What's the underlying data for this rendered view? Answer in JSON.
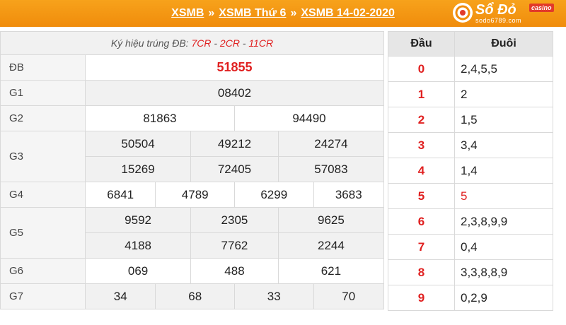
{
  "header": {
    "crumbs": [
      "XSMB",
      "XSMB Thứ 6",
      "XSMB 14-02-2020"
    ],
    "separator": "»",
    "background": "#f39515",
    "logo": {
      "name": "Sổ Đỏ",
      "badge": "casino",
      "url": "sodo6789.com"
    }
  },
  "results": {
    "note_prefix": "Ký hiệu trúng ĐB: ",
    "note_codes": [
      "7CR",
      "2CR",
      "11CR"
    ],
    "note_sep": " - ",
    "prizes": [
      {
        "label": "ĐB",
        "rows": [
          [
            "51855"
          ]
        ]
      },
      {
        "label": "G1",
        "rows": [
          [
            "08402"
          ]
        ]
      },
      {
        "label": "G2",
        "rows": [
          [
            "81863",
            "94490"
          ]
        ]
      },
      {
        "label": "G3",
        "rows": [
          [
            "50504",
            "49212",
            "24274"
          ],
          [
            "15269",
            "72405",
            "57083"
          ]
        ]
      },
      {
        "label": "G4",
        "rows": [
          [
            "6841",
            "4789",
            "6299",
            "3683"
          ]
        ]
      },
      {
        "label": "G5",
        "rows": [
          [
            "9592",
            "2305",
            "9625"
          ],
          [
            "4188",
            "7762",
            "2244"
          ]
        ]
      },
      {
        "label": "G6",
        "rows": [
          [
            "069",
            "488",
            "621"
          ]
        ]
      },
      {
        "label": "G7",
        "rows": [
          [
            "34",
            "68",
            "33",
            "70"
          ]
        ]
      }
    ]
  },
  "dau_duoi": {
    "headers": [
      "Đầu",
      "Đuôi"
    ],
    "rows": [
      {
        "dau": "0",
        "duoi": "2,4,5,5"
      },
      {
        "dau": "1",
        "duoi": "2"
      },
      {
        "dau": "2",
        "duoi": "1,5"
      },
      {
        "dau": "3",
        "duoi": "3,4"
      },
      {
        "dau": "4",
        "duoi": "1,4"
      },
      {
        "dau": "5",
        "duoi": "5"
      },
      {
        "dau": "6",
        "duoi": "2,3,8,9,9"
      },
      {
        "dau": "7",
        "duoi": "0,4"
      },
      {
        "dau": "8",
        "duoi": "3,3,8,8,9"
      },
      {
        "dau": "9",
        "duoi": "0,2,9"
      }
    ]
  },
  "colors": {
    "accent_red": "#e02020",
    "header_orange": "#f39515"
  }
}
